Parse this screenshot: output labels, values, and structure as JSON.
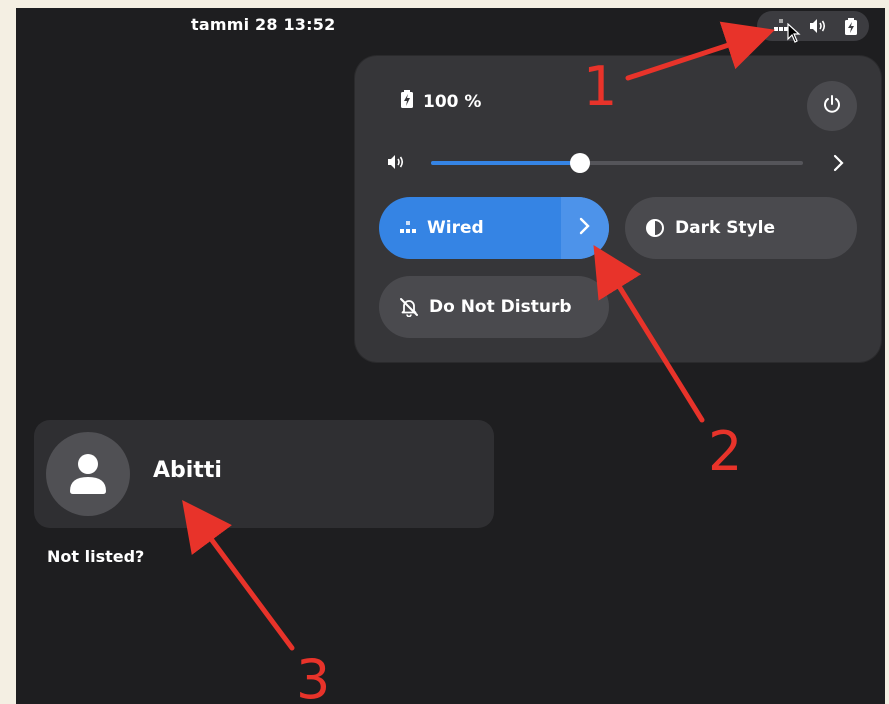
{
  "topbar": {
    "clock": "tammi 28  13:52",
    "tray_icons": [
      "network-wired-icon",
      "speaker-icon",
      "battery-icon"
    ]
  },
  "quick_settings": {
    "battery_label": "100 %",
    "volume_level": 0.4,
    "tiles": {
      "wired": "Wired",
      "dark_style": "Dark Style",
      "do_not_disturb": "Do Not Disturb"
    }
  },
  "login": {
    "user_name": "Abitti",
    "not_listed": "Not listed?"
  },
  "annotations": [
    "1",
    "2",
    "3"
  ],
  "colors": {
    "accent": "#3584e4",
    "annotation": "#e8332a",
    "background": "#1e1e20",
    "panel": "#363639"
  }
}
